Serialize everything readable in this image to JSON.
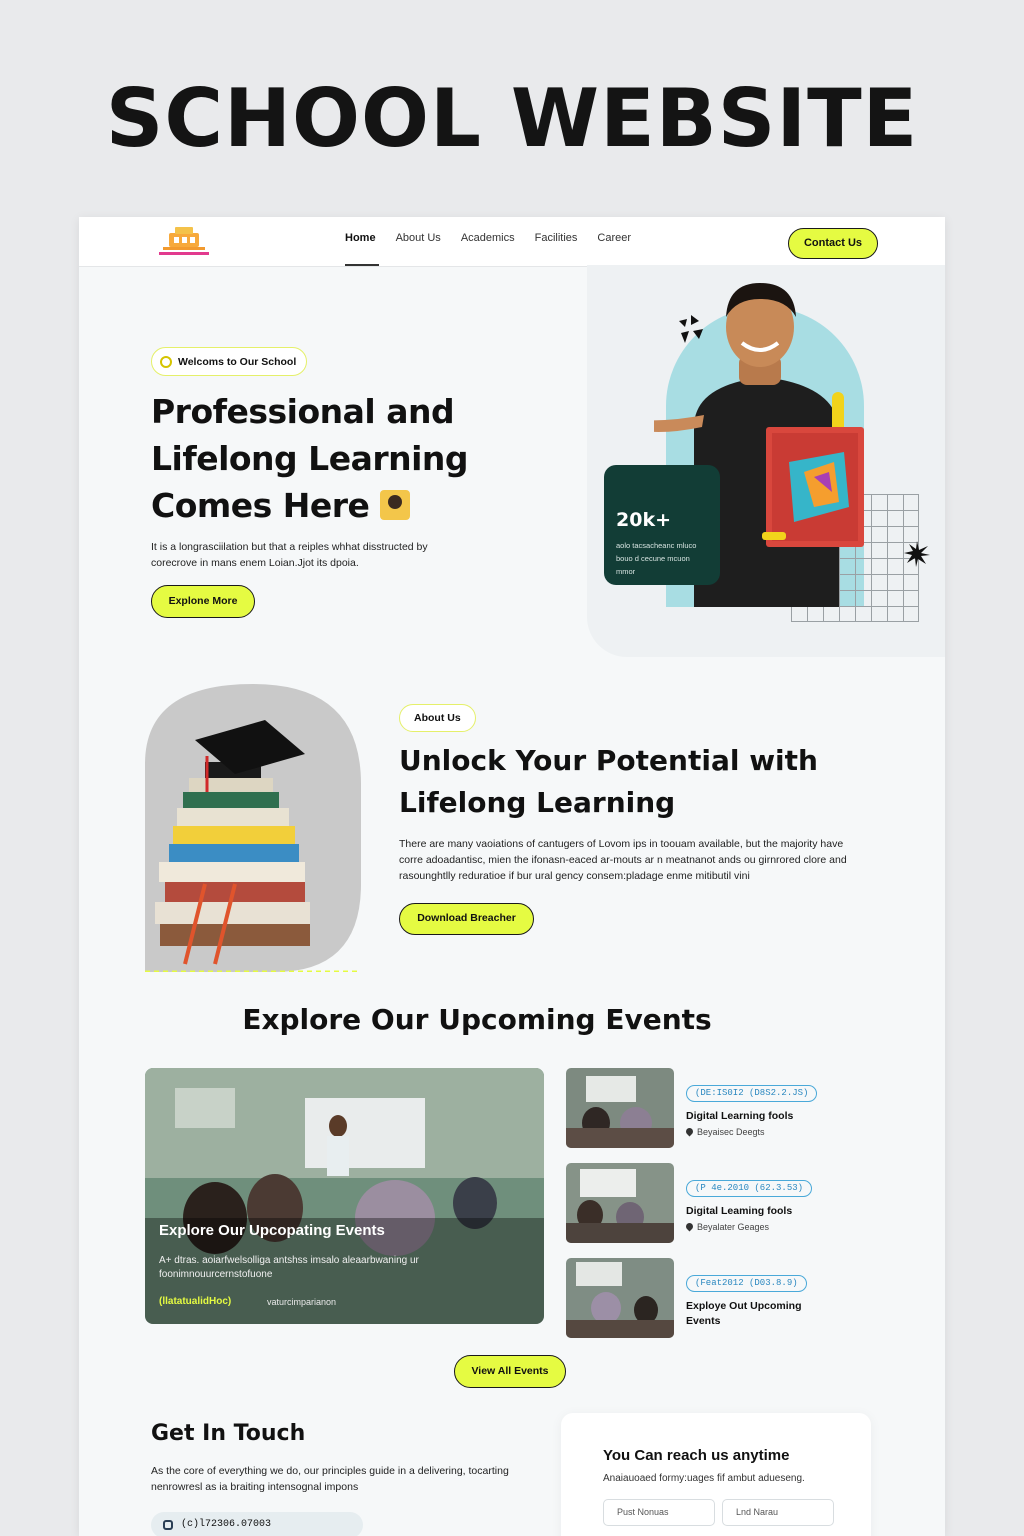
{
  "poster": {
    "title": "SCHOOL WEBSITE"
  },
  "nav": {
    "items": [
      "Home",
      "About Us",
      "Academics",
      "Facilities",
      "Career"
    ],
    "contact_label": "Contact Us"
  },
  "hero": {
    "badge": "Welcoms to Our School",
    "title_line1": "Professional and",
    "title_line2": "Lifelong Learning",
    "title_line3": "Comes Here",
    "description": "It is a longrasciilation but that a reiples whhat disstructed by corecrove in mans enem Loian.Jjot its dpoia.",
    "cta": "Explone More",
    "stat_value": "20k+",
    "stat_text": "aolo tacsacheanc mluco bouo d cecune mcuon mmor"
  },
  "about": {
    "badge": "About Us",
    "title_line1": "Unlock Your Potential with",
    "title_line2": "Lifelong Learning",
    "description": "There are many vaoiations of cantugers of Lovom ips in toouam available, but the majority have corre adoadantisc, mien the ifonasn-eaced ar-mouts ar n meatnanot ands ou girnrored clore and rasounghtlly reduratioe if bur ural gency consem:pladage enme mitibutil vini",
    "cta": "Download Breacher"
  },
  "events": {
    "title": "Explore Our Upcoming Events",
    "featured": {
      "title": "Explore Our Upcopating Events",
      "description": "A+ dtras. aoiarfwelsolliga antshss imsalo aleaarbwaning ur foonimnouurcernstofuone",
      "tag": "(llatatualidHoc)",
      "tag2": "vaturcimparianon"
    },
    "items": [
      {
        "date": "(DE:IS0I2 (D8S2.2.JS)",
        "name": "Digital Learning fools",
        "location": "Beyaisec Deegts"
      },
      {
        "date": "(P 4e.2010 (62.3.53)",
        "name": "Digital Leaming fools",
        "location": "Beyalater Geages"
      },
      {
        "date": "(Feat2012 (D03.8.9)",
        "name": "Exploye Out Upcoming Events",
        "location": ""
      }
    ],
    "view_all": "View All Events"
  },
  "contact": {
    "title": "Get In Touch",
    "description": "As the core of everything we do, our principles guide in a delivering, tocarting nenrowresl as ia braiting intensognal impons",
    "phone": "(c)l72306.07003",
    "form_title": "You Can reach us anytime",
    "form_sub": "Anaiauoaed formy:uages fif ambut adueseng.",
    "first_name_placeholder": "Pust Nonuas",
    "last_name_placeholder": "Lnd Narau"
  },
  "colors": {
    "accent": "#e5fb42",
    "dark_card": "#123d36",
    "arch": "#a8dde3"
  }
}
